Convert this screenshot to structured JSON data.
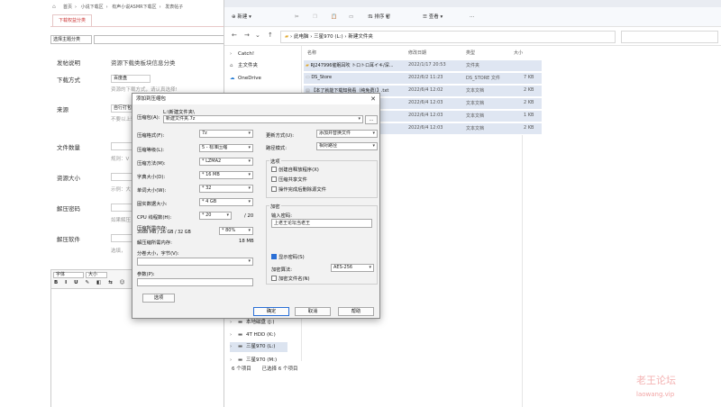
{
  "forum": {
    "breadcrumb": [
      "首页",
      "小说下载区",
      "有声小说ASMR下载区",
      "发表帖子"
    ],
    "tab": "下载权益分类",
    "theme_select": "选择主题分类",
    "fields": [
      {
        "label": "发帖说明",
        "hint": "资源下载类板块信息分类"
      },
      {
        "label": "下载方式",
        "select": "百度盘",
        "hint": "资源的下载方式，请认真选择!"
      },
      {
        "label": "来源",
        "select": "自行打包",
        "hint": "不要以上转载..."
      },
      {
        "label": "文件数量",
        "hint": "规则：V"
      },
      {
        "label": "资源大小",
        "hint": "示例：大"
      },
      {
        "label": "解压密码",
        "hint": "如果解压"
      },
      {
        "label": "解压软件",
        "hint": "选填，"
      }
    ],
    "editor_font": "字体",
    "editor_size": "大小"
  },
  "explorer": {
    "toolbar": {
      "new": "新建",
      "sort": "排序",
      "view": "查看"
    },
    "address": [
      "此电脑",
      "三星970 (L:)",
      "新建文件夹"
    ],
    "nav": [
      {
        "label": "Catch!",
        "icon": "pin-icon"
      },
      {
        "label": "主文件夹",
        "icon": "home-icon"
      },
      {
        "label": "OneDrive",
        "icon": "cloud-icon"
      },
      {
        "label": "本地磁盘 (J:)",
        "icon": "drive-icon"
      },
      {
        "label": "4T HDD (K:)",
        "icon": "drive-icon"
      },
      {
        "label": "三星970 (L:)",
        "icon": "drive-icon"
      },
      {
        "label": "三星970 (M:)",
        "icon": "drive-icon"
      }
    ],
    "columns": [
      "名称",
      "修改日期",
      "类型",
      "大小"
    ],
    "files": [
      {
        "name": "RJ247996催眠耳吹 トロトロ耳イキ/深...",
        "date": "2022/1/17 20:53",
        "type": "文件夹",
        "size": ""
      },
      {
        "name": "DS_Store",
        "date": "2022/6/2 11:23",
        "type": "DS_STORE 文件",
        "size": "7 KB"
      },
      {
        "name": "【本了就能下载知我看（纯免费）】.txt",
        "date": "2022/6/4 12:02",
        "type": "文本文档",
        "size": "2 KB"
      },
      {
        "name": "",
        "date": "2022/6/4 12:03",
        "type": "文本文档",
        "size": "2 KB"
      },
      {
        "name": "",
        "date": "2022/6/4 12:03",
        "type": "文本文档",
        "size": "1 KB"
      },
      {
        "name": "",
        "date": "2022/6/4 12:03",
        "type": "文本文档",
        "size": "2 KB"
      }
    ],
    "status": [
      "6 个项目",
      "已选择 6 个项目"
    ]
  },
  "dialog": {
    "title": "添加到压缩包",
    "archive_label": "压缩包(A):",
    "archive_path": "L:\\新建文件夹\\",
    "archive_name": "新建文件夹.7z",
    "browse": "...",
    "left_rows": [
      {
        "label": "压缩格式(F):",
        "value": "7z"
      },
      {
        "label": "压缩等级(L):",
        "value": "5 - 标准压缩"
      },
      {
        "label": "压缩方法(M):",
        "value": "* LZMA2"
      },
      {
        "label": "字典大小(D):",
        "value": "* 16 MB"
      },
      {
        "label": "单词大小(W):",
        "value": "* 32"
      },
      {
        "label": "固实数据大小:",
        "value": "* 4 GB"
      },
      {
        "label": "CPU 线程数(H):",
        "value": "* 20",
        "suffix": "/ 20"
      }
    ],
    "mem_label": "压缩所需内存:",
    "mem_value": "3088 MB / 26 GB / 32 GB",
    "mem_pct": "* 80%",
    "decomp_label": "解压缩所需内存:",
    "decomp_value": "18 MB",
    "split_label": "分卷大小，字节(V):",
    "params_label": "参数(P):",
    "options_btn": "选项",
    "update_label": "更新方式(U):",
    "update_value": "添加并替换文件",
    "path_label": "路径模式:",
    "path_value": "相对路径",
    "opts_title": "选项",
    "opts": [
      {
        "label": "创建自释放程序(X)",
        "checked": false
      },
      {
        "label": "压缩共享文件",
        "checked": false
      },
      {
        "label": "操作完成后删除源文件",
        "checked": false
      }
    ],
    "enc_title": "加密",
    "pwd_label": "输入密码:",
    "pwd_value": "上老王论坛当老王",
    "show_pwd": "显示密码(S)",
    "enc_method_label": "加密算法:",
    "enc_method": "AES-256",
    "enc_names": "加密文件名(N)",
    "ok": "确定",
    "cancel": "取消",
    "help": "帮助"
  },
  "watermark": {
    "cn": "老王论坛",
    "url": "laowang.vip"
  }
}
